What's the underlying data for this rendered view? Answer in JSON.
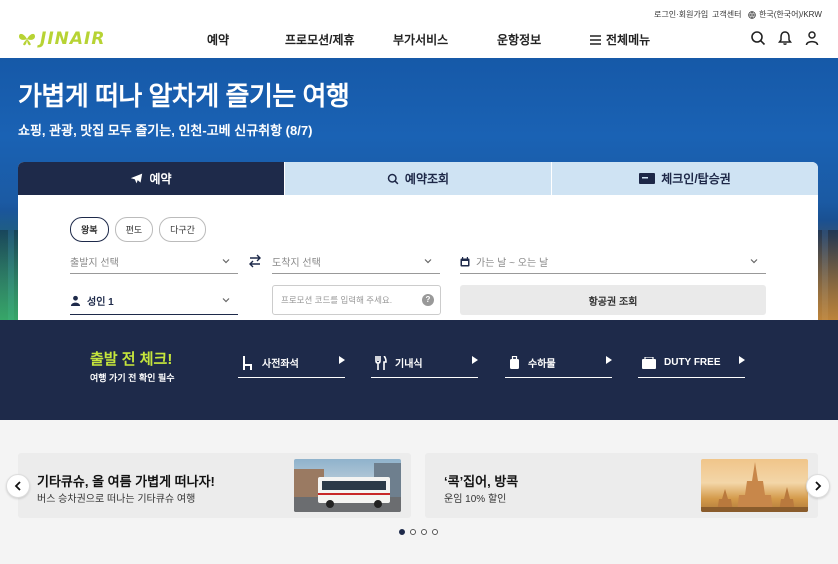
{
  "util": {
    "login": "로그인·회원가입",
    "support": "고객센터",
    "locale": "한국(한국어)/KRW"
  },
  "header": {
    "logo_text": "JINAIR",
    "nav": [
      "예약",
      "프로모션/제휴",
      "부가서비스",
      "운항정보",
      "전체메뉴"
    ]
  },
  "hero": {
    "title": "가볍게 떠나 알차게 즐기는 여행",
    "subtitle": "쇼핑, 관광, 맛집 모두 즐기는, 인천-고베 신규취항 (8/7)"
  },
  "booking": {
    "tabs": [
      "예약",
      "예약조회",
      "체크인/탑승권"
    ],
    "trip_types": [
      "왕복",
      "편도",
      "다구간"
    ],
    "origin_placeholder": "출발지 선택",
    "destination_placeholder": "도착지 선택",
    "date_placeholder": "가는 날 ~ 오는 날",
    "passengers": "성인 1",
    "promo_placeholder": "프로모션 코드를 입력해 주세요.",
    "search_button": "항공권 조회"
  },
  "check": {
    "title": "출발 전 체크!",
    "subtitle": "여행 가기 전 확인 필수",
    "items": [
      "사전좌석",
      "기내식",
      "수하물",
      "DUTY FREE"
    ]
  },
  "promos": [
    {
      "title": "기타큐슈, 올 여름 가볍게 떠나자!",
      "desc": "버스 승차권으로 떠나는 기타큐슈 여행"
    },
    {
      "title": "‘콕’집어, 방콕",
      "desc": "운임 10% 할인"
    }
  ],
  "colors": {
    "brand_navy": "#1e2a4a",
    "brand_lime": "#c6e63c",
    "tab_inactive": "#cfe3f3"
  }
}
